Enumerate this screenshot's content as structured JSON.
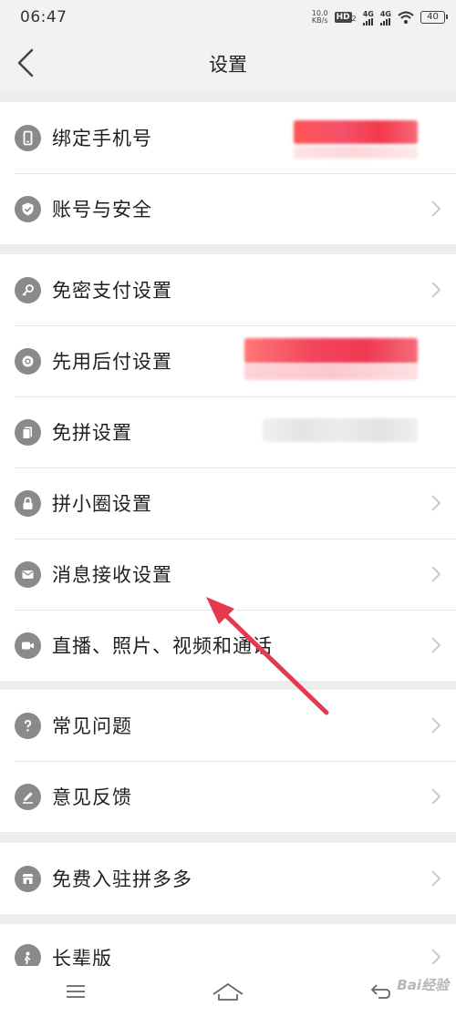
{
  "status_bar": {
    "time": "06:47",
    "speed_value": "10.0",
    "speed_unit": "KB/s",
    "hd": "HD",
    "hd_sub": "2",
    "network_1": "4G",
    "network_2": "4G",
    "battery": "40"
  },
  "header": {
    "title": "设置"
  },
  "groups": [
    {
      "items": [
        {
          "label": "绑定手机号",
          "icon": "phone-icon"
        },
        {
          "label": "账号与安全",
          "icon": "shield-check-icon"
        }
      ]
    },
    {
      "items": [
        {
          "label": "免密支付设置",
          "icon": "key-icon"
        },
        {
          "label": "先用后付设置",
          "icon": "badge-gear-icon"
        },
        {
          "label": "免拼设置",
          "icon": "cards-icon"
        },
        {
          "label": "拼小圈设置",
          "icon": "lock-icon"
        },
        {
          "label": "消息接收设置",
          "icon": "envelope-icon"
        },
        {
          "label": "直播、照片、视频和通话",
          "icon": "video-camera-icon"
        }
      ]
    },
    {
      "items": [
        {
          "label": "常见问题",
          "icon": "question-icon"
        },
        {
          "label": "意见反馈",
          "icon": "pencil-icon"
        }
      ]
    },
    {
      "items": [
        {
          "label": "免费入驻拼多多",
          "icon": "store-icon"
        }
      ]
    },
    {
      "items": [
        {
          "label": "长辈版",
          "icon": "elder-icon"
        }
      ]
    }
  ],
  "watermark": "Bai经验",
  "colors": {
    "annotation_arrow": "#e5394d",
    "redaction_red": "#f24a5c",
    "icon_gray": "#8a8a8a",
    "separator": "#ececec"
  }
}
